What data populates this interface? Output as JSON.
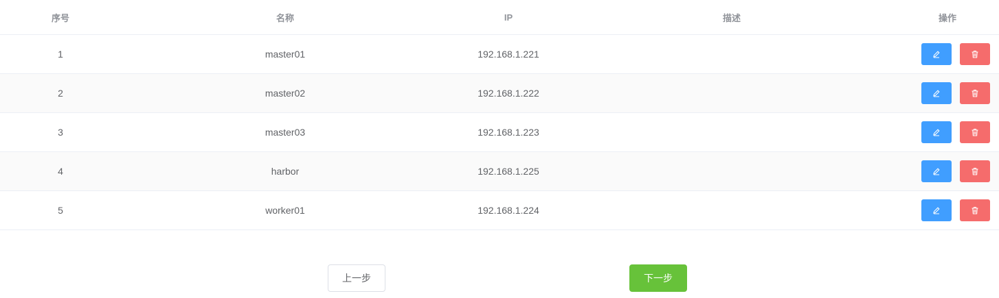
{
  "table": {
    "columns": {
      "index": "序号",
      "name": "名称",
      "ip": "IP",
      "description": "描述",
      "operations": "操作"
    },
    "rows": [
      {
        "index": "1",
        "name": "master01",
        "ip": "192.168.1.221",
        "description": ""
      },
      {
        "index": "2",
        "name": "master02",
        "ip": "192.168.1.222",
        "description": ""
      },
      {
        "index": "3",
        "name": "master03",
        "ip": "192.168.1.223",
        "description": ""
      },
      {
        "index": "4",
        "name": "harbor",
        "ip": "192.168.1.225",
        "description": ""
      },
      {
        "index": "5",
        "name": "worker01",
        "ip": "192.168.1.224",
        "description": ""
      }
    ],
    "row_actions": {
      "edit_icon": "edit-icon",
      "delete_icon": "trash-icon"
    }
  },
  "footer": {
    "prev_label": "上一步",
    "next_label": "下一步"
  },
  "colors": {
    "edit_button": "#409eff",
    "delete_button": "#f56c6c",
    "next_button": "#67c23a",
    "striped_row": "#fafafa"
  }
}
